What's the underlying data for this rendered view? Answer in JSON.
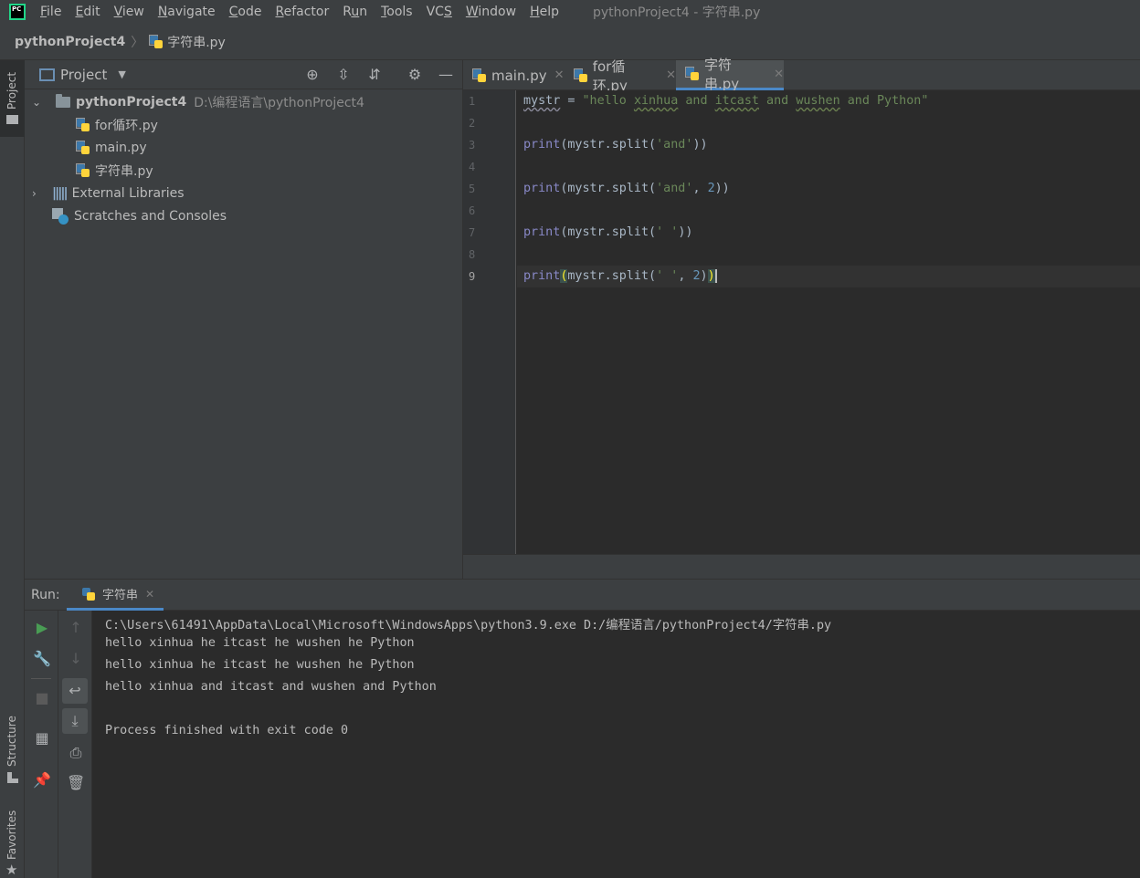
{
  "menubar": {
    "items": [
      {
        "label": "File",
        "mnemonic_index": 0
      },
      {
        "label": "Edit",
        "mnemonic_index": 0
      },
      {
        "label": "View",
        "mnemonic_index": 0
      },
      {
        "label": "Navigate",
        "mnemonic_index": 0
      },
      {
        "label": "Code",
        "mnemonic_index": 0
      },
      {
        "label": "Refactor",
        "mnemonic_index": 0
      },
      {
        "label": "Run",
        "mnemonic_index": 1
      },
      {
        "label": "Tools",
        "mnemonic_index": 0
      },
      {
        "label": "VCS",
        "mnemonic_index": 2
      },
      {
        "label": "Window",
        "mnemonic_index": 0
      },
      {
        "label": "Help",
        "mnemonic_index": 0
      }
    ],
    "window_title": "pythonProject4 - 字符串.py",
    "logo_text": "PC"
  },
  "breadcrumb": {
    "project": "pythonProject4",
    "separator": "〉",
    "file": "字符串.py"
  },
  "left_strip": {
    "project_label": "Project",
    "structure_label": "Structure",
    "favorites_label": "Favorites"
  },
  "project_panel": {
    "title": "Project",
    "tree": {
      "root_name": "pythonProject4",
      "root_path": "D:\\编程语言\\pythonProject4",
      "files": [
        "for循环.py",
        "main.py",
        "字符串.py"
      ],
      "external_libraries": "External Libraries",
      "scratches": "Scratches and Consoles"
    }
  },
  "editor": {
    "tabs": [
      {
        "label": "main.py",
        "active": false
      },
      {
        "label": "for循环.py",
        "active": false
      },
      {
        "label": "字符串.py",
        "active": true
      }
    ],
    "line_numbers": [
      "1",
      "2",
      "3",
      "4",
      "5",
      "6",
      "7",
      "8",
      "9"
    ],
    "code": {
      "l1_var": "mystr",
      "l1_op": " = ",
      "l1_q": "\"hello ",
      "l1_w1": "xinhua",
      "l1_s1": " and ",
      "l1_w2": "itcast",
      "l1_s2": " and ",
      "l1_w3": "wushen",
      "l1_s3": " and Python\"",
      "print_kw": "print",
      "l3_a": "(mystr.split(",
      "l3_str": "'and'",
      "l3_b": "))",
      "l5_a": "(mystr.split(",
      "l5_str": "'and'",
      "l5_c": ", ",
      "l5_num": "2",
      "l5_b": "))",
      "l7_a": "(mystr.split(",
      "l7_str": "' '",
      "l7_b": "))",
      "l9_p": "(",
      "l9_a": "mystr.split(",
      "l9_str": "' '",
      "l9_c": ", ",
      "l9_num": "2",
      "l9_b": ")",
      "l9_close": ")"
    }
  },
  "run_panel": {
    "label": "Run:",
    "tab_label": "字符串",
    "console_lines": [
      "C:\\Users\\61491\\AppData\\Local\\Microsoft\\WindowsApps\\python3.9.exe D:/编程语言/pythonProject4/字符串.py",
      "hello xinhua he itcast he wushen he Python",
      "hello xinhua he itcast he wushen he Python",
      "hello xinhua and itcast and wushen and Python",
      "",
      "Process finished with exit code 0"
    ]
  },
  "colors": {
    "accent": "#4a88c7",
    "keyword": "#8888c6",
    "string": "#6a8759",
    "number": "#6897bb",
    "run_green": "#499c54"
  }
}
